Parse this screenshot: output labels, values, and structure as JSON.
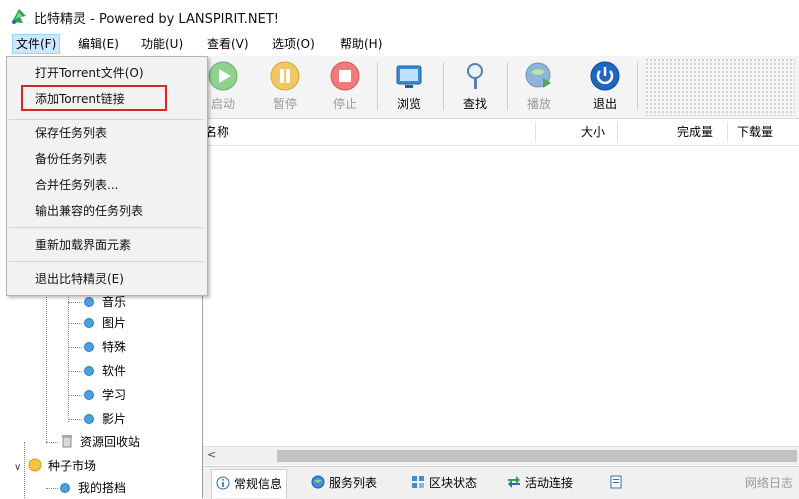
{
  "window": {
    "title": "比特精灵 - Powered by LANSPIRIT.NET!"
  },
  "menubar": {
    "items": [
      {
        "label": "文件(F)"
      },
      {
        "label": "编辑(E)"
      },
      {
        "label": "功能(U)"
      },
      {
        "label": "查看(V)"
      },
      {
        "label": "选项(O)"
      },
      {
        "label": "帮助(H)"
      }
    ]
  },
  "file_menu": {
    "items": [
      {
        "label": "打开Torrent文件(O)"
      },
      {
        "label": "添加Torrent链接"
      },
      {
        "label": "保存任务列表"
      },
      {
        "label": "备份任务列表"
      },
      {
        "label": "合并任务列表..."
      },
      {
        "label": "输出兼容的任务列表"
      },
      {
        "label": "重新加载界面元素"
      },
      {
        "label": "退出比特精灵(E)"
      }
    ]
  },
  "toolbar": {
    "buttons": [
      {
        "label": "启动",
        "icon": "play-icon",
        "enabled": false
      },
      {
        "label": "暂停",
        "icon": "pause-icon",
        "enabled": false
      },
      {
        "label": "停止",
        "icon": "stop-icon",
        "enabled": false
      },
      {
        "label": "浏览",
        "icon": "browse-icon",
        "enabled": true
      },
      {
        "label": "查找",
        "icon": "search-icon",
        "enabled": true
      },
      {
        "label": "播放",
        "icon": "play-media-icon",
        "enabled": false
      },
      {
        "label": "退出",
        "icon": "power-icon",
        "enabled": true
      }
    ]
  },
  "list": {
    "columns": [
      {
        "label": "名称"
      },
      {
        "label": "大小"
      },
      {
        "label": "完成量"
      },
      {
        "label": "下载量"
      }
    ]
  },
  "tree": {
    "items": [
      {
        "label": "音乐"
      },
      {
        "label": "图片"
      },
      {
        "label": "特殊"
      },
      {
        "label": "软件"
      },
      {
        "label": "学习"
      },
      {
        "label": "影片"
      },
      {
        "label": "资源回收站"
      },
      {
        "label": "种子市场"
      },
      {
        "label": "我的搭档"
      }
    ]
  },
  "bottom_tabs": {
    "items": [
      {
        "label": "常规信息"
      },
      {
        "label": "服务列表"
      },
      {
        "label": "区块状态"
      },
      {
        "label": "活动连接"
      },
      {
        "label": "网络日志"
      }
    ]
  },
  "colors": {
    "accent_highlight": "#d9262b",
    "menu_active": "#cce8ff",
    "tree_bullet": "#4a9fe0"
  }
}
